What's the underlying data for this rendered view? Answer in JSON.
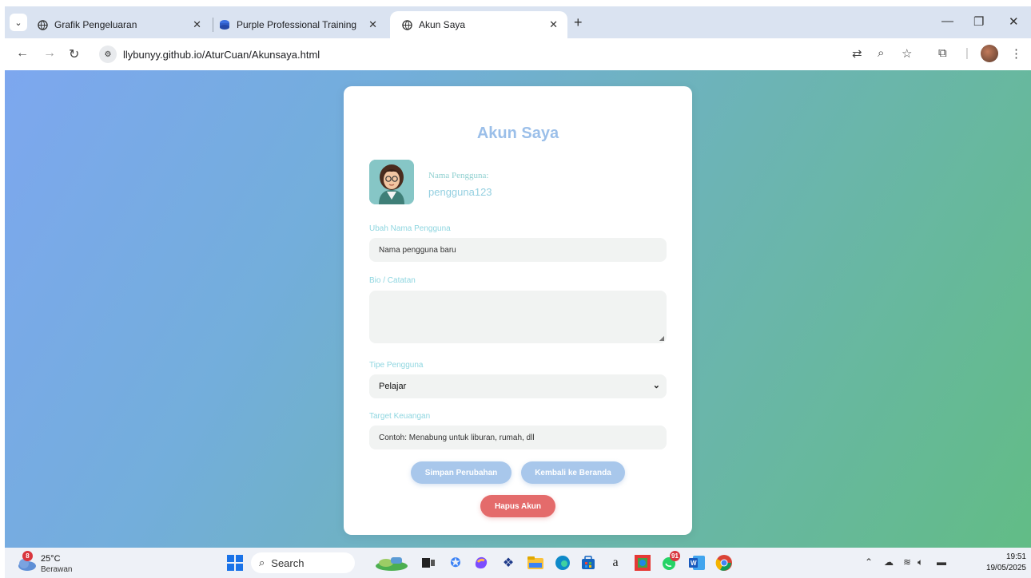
{
  "browser": {
    "tabs": [
      {
        "title": "Grafik Pengeluaran",
        "active": false,
        "icon": "globe-icon"
      },
      {
        "title": "Purple Professional Training Ma",
        "active": false,
        "icon": "blue-disc-icon"
      },
      {
        "title": "Akun Saya",
        "active": true,
        "icon": "globe-icon"
      }
    ],
    "url": "llybunyy.github.io/AturCuan/Akunsaya.html"
  },
  "page": {
    "title": "Akun Saya",
    "username_label": "Nama Pengguna:",
    "username_value": "pengguna123",
    "fields": {
      "rename_label": "Ubah Nama Pengguna",
      "rename_placeholder": "Nama pengguna baru",
      "bio_label": "Bio / Catatan",
      "bio_value": "",
      "type_label": "Tipe Pengguna",
      "type_selected": "Pelajar",
      "target_label": "Target Keuangan",
      "target_placeholder": "Contoh: Menabung untuk liburan, rumah, dll"
    },
    "buttons": {
      "save": "Simpan Perubahan",
      "back": "Kembali ke Beranda",
      "delete": "Hapus Akun"
    },
    "colors": {
      "title": "#9bbfe9",
      "label": "#8fd6e0",
      "button_blue": "#a8c7eb",
      "button_red": "#e46b6b",
      "gradient_start": "#7da7ef",
      "gradient_end": "#62bc86"
    }
  },
  "taskbar": {
    "weather_badge": "8",
    "temperature": "25°C",
    "weather_desc": "Berawan",
    "search_label": "Search",
    "chrome_badge": "91",
    "time": "19:51",
    "date": "19/05/2025"
  }
}
